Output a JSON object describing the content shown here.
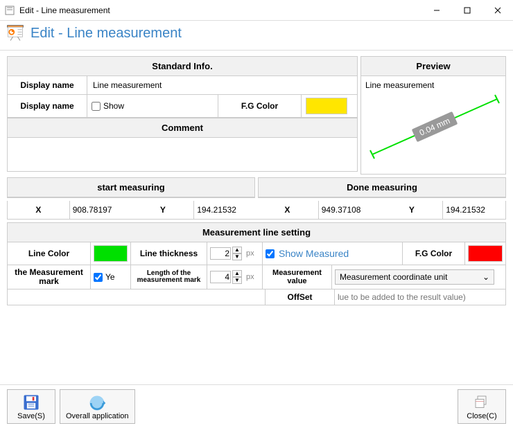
{
  "window": {
    "title": "Edit - Line measurement"
  },
  "header": {
    "title": "Edit - Line measurement"
  },
  "std_info": {
    "section_title": "Standard Info.",
    "displayname_label": "Display name",
    "displayname_value": "Line measurement",
    "displayname2_label": "Display name",
    "show_label": "Show",
    "fg_label": "F.G Color",
    "fg_color": "#ffe600",
    "comment_label": "Comment",
    "comment_value": ""
  },
  "preview": {
    "section_title": "Preview",
    "label": "Line measurement",
    "measurement": "0.04 mm"
  },
  "start": {
    "section_title": "start measuring",
    "x_label": "X",
    "x_value": "908.78197",
    "y_label": "Y",
    "y_value": "194.21532"
  },
  "done": {
    "section_title": "Done measuring",
    "x_label": "X",
    "x_value": "949.37108",
    "y_label": "Y",
    "y_value": "194.21532"
  },
  "meas": {
    "section_title": "Measurement line setting",
    "line_color_label": "Line Color",
    "line_color": "#00e000",
    "line_thickness_label": "Line thickness",
    "line_thickness_value": "2",
    "px_unit": "px",
    "show_measured_label": "Show Measured",
    "fg_color_label": "F.G Color",
    "fg_color": "#ff0000",
    "mark_label": "the Measurement mark",
    "mark_check": "Ye",
    "mark_len_label": "Length of the measurement mark",
    "mark_len_value": "4",
    "mval_label": "Measurement value",
    "mval_select": "Measurement coordinate unit",
    "offset_label": "OffSet",
    "offset_placeholder": "lue to be added to the result value)"
  },
  "footer": {
    "save": "Save(S)",
    "overall": "Overall application",
    "close": "Close(C)"
  }
}
